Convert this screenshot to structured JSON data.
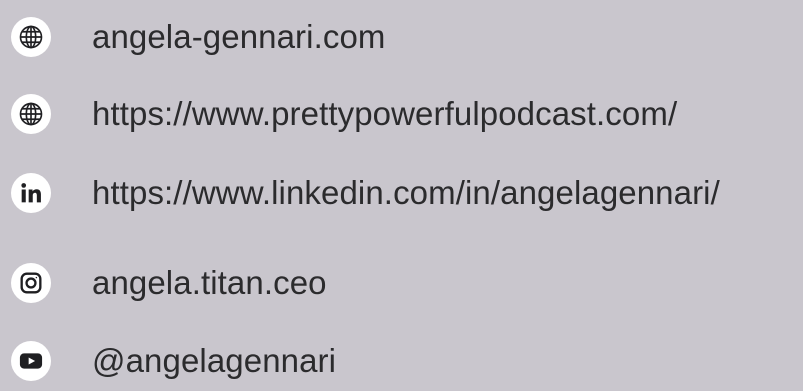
{
  "links": [
    {
      "icon": "globe-icon",
      "text": "angela-gennari.com"
    },
    {
      "icon": "globe-icon",
      "text": "https://www.prettypowerfulpodcast.com/"
    },
    {
      "icon": "linkedin-icon",
      "text": "https://www.linkedin.com/in/angelagennari/"
    },
    {
      "icon": "instagram-icon",
      "text": "angela.titan.ceo"
    },
    {
      "icon": "youtube-icon",
      "text": "@angelagennari"
    }
  ],
  "colors": {
    "background": "#c9c6cd",
    "badge": "#ffffff",
    "icon": "#1f1f22",
    "text": "#2b2b2d"
  }
}
